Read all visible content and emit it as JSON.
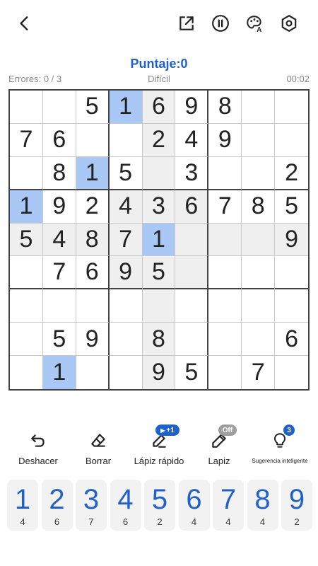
{
  "header": {
    "icons": [
      "back-icon",
      "share-icon",
      "pause-icon",
      "theme-palette-icon",
      "settings-icon"
    ]
  },
  "score": {
    "label": "Puntaje:",
    "value": "0"
  },
  "status": {
    "errors": "Errores: 0 / 3",
    "difficulty": "Difícil",
    "timer": "00:02"
  },
  "board": {
    "cells": [
      [
        "",
        "",
        "5",
        "1",
        "6",
        "9",
        "8",
        "",
        ""
      ],
      [
        "7",
        "6",
        "",
        "",
        "2",
        "4",
        "9",
        "",
        ""
      ],
      [
        "",
        "8",
        "1",
        "5",
        "",
        "3",
        "",
        "",
        "2"
      ],
      [
        "1",
        "9",
        "2",
        "4",
        "3",
        "6",
        "7",
        "8",
        "5"
      ],
      [
        "5",
        "4",
        "8",
        "7",
        "1",
        "",
        "",
        "",
        "9"
      ],
      [
        "",
        "7",
        "6",
        "9",
        "5",
        "",
        "",
        "",
        ""
      ],
      [
        "",
        "",
        "",
        "",
        "",
        "",
        "",
        "",
        ""
      ],
      [
        "",
        "5",
        "9",
        "",
        "8",
        "",
        "",
        "",
        "6"
      ],
      [
        "",
        "1",
        "",
        "",
        "9",
        "5",
        "",
        "7",
        ""
      ]
    ],
    "selected": [
      4,
      4
    ],
    "same_number_cells": [
      [
        0,
        3
      ],
      [
        2,
        2
      ],
      [
        3,
        0
      ],
      [
        8,
        1
      ]
    ],
    "highlight_color": "#efefef",
    "selected_color": "#a9c8f6"
  },
  "tools": {
    "undo": {
      "label": "Deshacer",
      "icon": "undo-icon"
    },
    "erase": {
      "label": "Borrar",
      "icon": "eraser-icon"
    },
    "fast_pencil": {
      "label": "Lápiz rápido",
      "icon": "fast-pencil-icon",
      "badge": "+1"
    },
    "pencil": {
      "label": "Lapiz",
      "icon": "pencil-icon",
      "badge": "Off"
    },
    "hint": {
      "label": "Sugerencia inteligente",
      "icon": "lightbulb-icon",
      "badge": "3"
    }
  },
  "keypad": [
    {
      "num": "1",
      "count": "4"
    },
    {
      "num": "2",
      "count": "6"
    },
    {
      "num": "3",
      "count": "7"
    },
    {
      "num": "4",
      "count": "6"
    },
    {
      "num": "5",
      "count": "2"
    },
    {
      "num": "6",
      "count": "4"
    },
    {
      "num": "7",
      "count": "4"
    },
    {
      "num": "8",
      "count": "4"
    },
    {
      "num": "9",
      "count": "2"
    }
  ],
  "colors": {
    "accent": "#1e62c9",
    "keypad_bg": "#f2f2f2"
  }
}
